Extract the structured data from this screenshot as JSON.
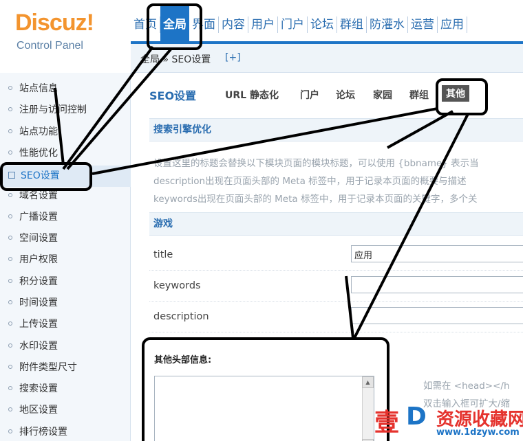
{
  "logo": {
    "title": "Discuz!",
    "subtitle": "Control Panel"
  },
  "topnav": {
    "items": [
      "首页",
      "全局",
      "界面",
      "内容",
      "用户",
      "门户",
      "论坛",
      "群组",
      "防灌水",
      "运营",
      "应用"
    ],
    "active_index": 1
  },
  "breadcrumb": {
    "text": "全局 » SEO设置",
    "add": "[+]"
  },
  "sidebar": {
    "items": [
      "站点信息",
      "注册与访问控制",
      "站点功能",
      "性能优化",
      "SEO设置",
      "域名设置",
      "广播设置",
      "空间设置",
      "用户权限",
      "积分设置",
      "时间设置",
      "上传设置",
      "水印设置",
      "附件类型尺寸",
      "搜索设置",
      "地区设置",
      "排行榜设置"
    ],
    "active_index": 4
  },
  "subtabs": {
    "main": "SEO设置",
    "items": [
      "URL 静态化",
      "门户",
      "论坛",
      "家园",
      "群组",
      "其他"
    ],
    "active_index": 5
  },
  "section_seo": {
    "title": "搜索引擎优化"
  },
  "tips": [
    "设置这里的标题会替换以下模块页面的模块标题，可以使用 {bbname} 表示当",
    "description出现在页面头部的 Meta 标签中，用于记录本页面的概要与描述",
    "keywords出现在页面头部的 Meta 标签中，用于记录本页面的关键字，多个关"
  ],
  "section_game": {
    "title": "游戏"
  },
  "fields": [
    {
      "label": "title",
      "value": "应用"
    },
    {
      "label": "keywords",
      "value": ""
    },
    {
      "label": "description",
      "value": ""
    }
  ],
  "other": {
    "label": "其他头部信息:",
    "value": ""
  },
  "side_notes": [
    "如需在 <head></h",
    "双击输入框可扩大/缩"
  ],
  "watermark": {
    "char1": "壹",
    "char2": "D",
    "text": "资源收藏网",
    "url": "www.1dzyw.com"
  },
  "colors": {
    "accent": "#1d74c6",
    "logo": "#f3942e",
    "watermark_red": "#e5322d"
  }
}
